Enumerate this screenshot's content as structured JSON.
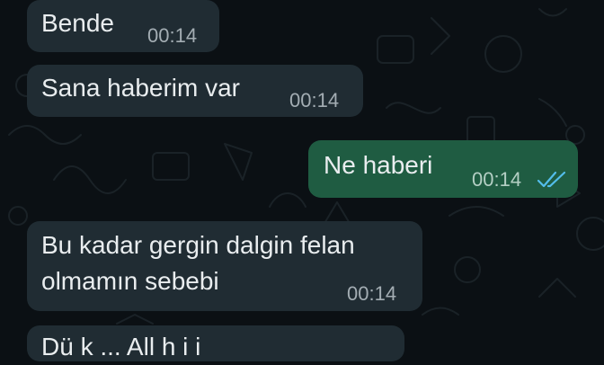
{
  "conversation": {
    "messages": [
      {
        "direction": "incoming",
        "text": "Bende",
        "time": "00:14"
      },
      {
        "direction": "incoming",
        "text": "Sana haberim var",
        "time": "00:14"
      },
      {
        "direction": "outgoing",
        "text": "Ne haberi",
        "time": "00:14",
        "status_icon": "double-check-read-icon"
      },
      {
        "direction": "incoming",
        "lines": [
          "Bu kadar gergin dalgin felan",
          "olmamın sebebi"
        ],
        "time": "00:14"
      },
      {
        "direction": "incoming",
        "text": "Dü  k  ...  All   h  i  i",
        "partial": true
      }
    ]
  },
  "colors": {
    "background": "#0b1014",
    "incoming_bubble": "#202c33",
    "outgoing_bubble": "#1f5c42",
    "read_ticks": "#53bdeb",
    "text": "#e9edef",
    "timestamp": "#a3adb3"
  }
}
